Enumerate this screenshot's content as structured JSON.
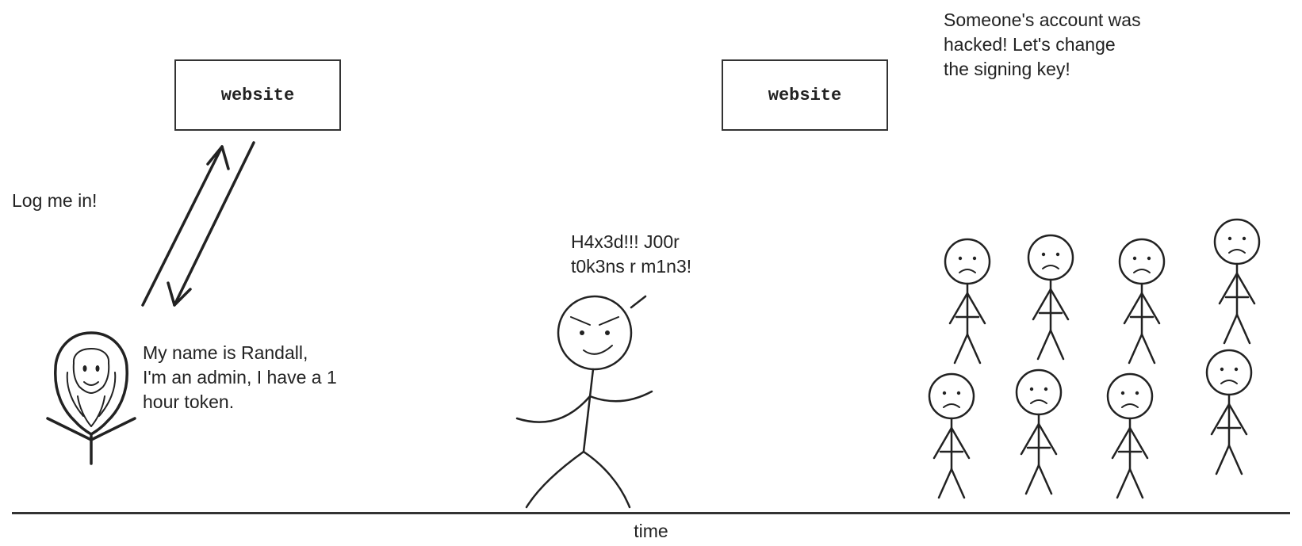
{
  "boxes": {
    "website1": "website",
    "website2": "website"
  },
  "captions": {
    "login": "Log me in!",
    "randall": "My name is Randall,\nI'm an admin, I have a 1\nhour token.",
    "hacker": "H4x3d!!! J00r\nt0k3ns r m1n3!",
    "hacked": "Someone's account was\nhacked! Let's change\nthe signing key!",
    "time": "time"
  }
}
